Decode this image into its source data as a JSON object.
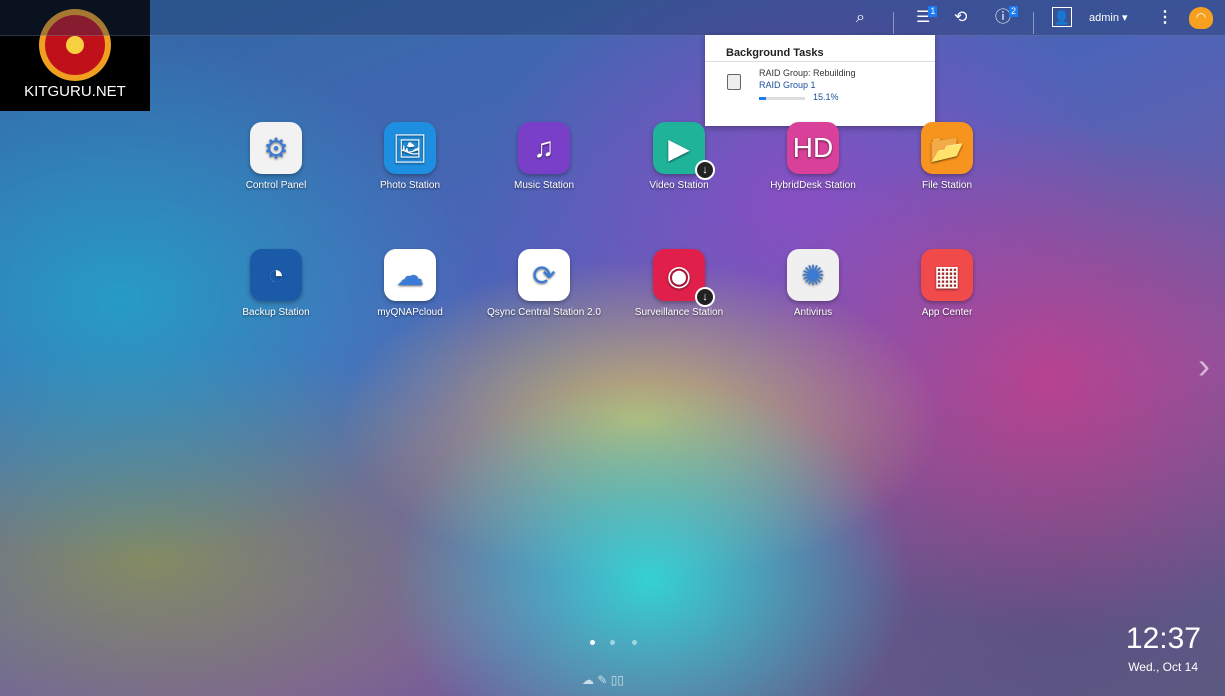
{
  "logo": {
    "text": "KitGuru.net"
  },
  "topbar": {
    "user": "admin",
    "tasks_badge": "1",
    "info_badge": "2"
  },
  "background_tasks": {
    "title": "Background Tasks",
    "task_name": "RAID Group: Rebuilding",
    "task_target": "RAID Group 1",
    "progress_text": "15.1%",
    "progress": 15.1
  },
  "apps": [
    {
      "label": "Control Panel",
      "icon": "gear-icon",
      "color": "#f2f2f2"
    },
    {
      "label": "Photo Station",
      "icon": "photo-icon",
      "color": "#1e8fe0"
    },
    {
      "label": "Music Station",
      "icon": "music-icon",
      "color": "#7a3fc8"
    },
    {
      "label": "Video Station",
      "icon": "video-icon",
      "color": "#1fb39a"
    },
    {
      "label": "HybridDesk Station",
      "icon": "hd-icon",
      "color": "#d8409a"
    },
    {
      "label": "File Station",
      "icon": "folder-icon",
      "color": "#f7941d"
    },
    {
      "label": "Backup Station",
      "icon": "backup-icon",
      "color": "#1a5aa8"
    },
    {
      "label": "myQNAPcloud",
      "icon": "cloud-icon",
      "color": "#ffffff"
    },
    {
      "label": "Qsync Central Station 2.0",
      "icon": "sync-icon",
      "color": "#ffffff"
    },
    {
      "label": "Surveillance Station",
      "icon": "camera-icon",
      "color": "#e0204a"
    },
    {
      "label": "Antivirus",
      "icon": "antivirus-icon",
      "color": "#f0f0f0"
    },
    {
      "label": "App Center",
      "icon": "grid-icon",
      "color": "#f04a4a"
    }
  ],
  "glyphs": [
    "⚙",
    "🖼",
    "♫",
    "▶",
    "HD",
    "📂",
    "◔",
    "☁",
    "⟳",
    "◉",
    "✺",
    "▦"
  ],
  "clock": {
    "time": "12:37",
    "date": "Wed., Oct 14"
  }
}
